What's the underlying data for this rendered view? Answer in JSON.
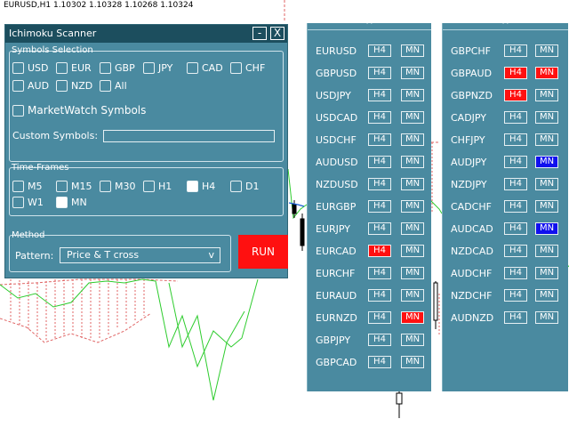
{
  "chart": {
    "header": "EURUSD,H1  1.10302 1.10328 1.10268 1.10324"
  },
  "dialog": {
    "title": "Ichimoku Scanner",
    "minimize_label": "-",
    "close_label": "X",
    "symbols_section_label": "Symbols Selection",
    "currencies": [
      {
        "label": "USD",
        "checked": false
      },
      {
        "label": "EUR",
        "checked": false
      },
      {
        "label": "GBP",
        "checked": false
      },
      {
        "label": "JPY",
        "checked": false
      },
      {
        "label": "CAD",
        "checked": false
      },
      {
        "label": "CHF",
        "checked": false
      },
      {
        "label": "AUD",
        "checked": false
      },
      {
        "label": "NZD",
        "checked": false
      },
      {
        "label": "All",
        "checked": false
      }
    ],
    "marketwatch_label": "MarketWatch Symbols",
    "custom_symbols_label": "Custom Symbols:",
    "custom_symbols_value": "",
    "timeframes_section_label": "Time-Frames",
    "timeframes": [
      {
        "label": "M5",
        "checked": false
      },
      {
        "label": "M15",
        "checked": false
      },
      {
        "label": "M30",
        "checked": false
      },
      {
        "label": "H1",
        "checked": false
      },
      {
        "label": "H4",
        "checked": true
      },
      {
        "label": "D1",
        "checked": false
      },
      {
        "label": "W1",
        "checked": false
      },
      {
        "label": "MN",
        "checked": true
      }
    ],
    "method_section_label": "Method",
    "pattern_label": "Pattern:",
    "pattern_value": "Price & T cross",
    "pattern_arrow": "v",
    "run_label": "RUN"
  },
  "panel_collapse_glyph": "^",
  "panels": [
    {
      "rows": [
        {
          "symbol": "EURUSD",
          "h4": {
            "label": "H4",
            "state": "none"
          },
          "mn": {
            "label": "MN",
            "state": "none"
          }
        },
        {
          "symbol": "GBPUSD",
          "h4": {
            "label": "H4",
            "state": "none"
          },
          "mn": {
            "label": "MN",
            "state": "none"
          }
        },
        {
          "symbol": "USDJPY",
          "h4": {
            "label": "H4",
            "state": "none"
          },
          "mn": {
            "label": "MN",
            "state": "none"
          }
        },
        {
          "symbol": "USDCAD",
          "h4": {
            "label": "H4",
            "state": "none"
          },
          "mn": {
            "label": "MN",
            "state": "none"
          }
        },
        {
          "symbol": "USDCHF",
          "h4": {
            "label": "H4",
            "state": "none"
          },
          "mn": {
            "label": "MN",
            "state": "none"
          }
        },
        {
          "symbol": "AUDUSD",
          "h4": {
            "label": "H4",
            "state": "none"
          },
          "mn": {
            "label": "MN",
            "state": "none"
          }
        },
        {
          "symbol": "NZDUSD",
          "h4": {
            "label": "H4",
            "state": "none"
          },
          "mn": {
            "label": "MN",
            "state": "none"
          }
        },
        {
          "symbol": "EURGBP",
          "h4": {
            "label": "H4",
            "state": "none"
          },
          "mn": {
            "label": "MN",
            "state": "none"
          }
        },
        {
          "symbol": "EURJPY",
          "h4": {
            "label": "H4",
            "state": "none"
          },
          "mn": {
            "label": "MN",
            "state": "none"
          }
        },
        {
          "symbol": "EURCAD",
          "h4": {
            "label": "H4",
            "state": "sell"
          },
          "mn": {
            "label": "MN",
            "state": "none"
          }
        },
        {
          "symbol": "EURCHF",
          "h4": {
            "label": "H4",
            "state": "none"
          },
          "mn": {
            "label": "MN",
            "state": "none"
          }
        },
        {
          "symbol": "EURAUD",
          "h4": {
            "label": "H4",
            "state": "none"
          },
          "mn": {
            "label": "MN",
            "state": "none"
          }
        },
        {
          "symbol": "EURNZD",
          "h4": {
            "label": "H4",
            "state": "none"
          },
          "mn": {
            "label": "MN",
            "state": "sell"
          }
        },
        {
          "symbol": "GBPJPY",
          "h4": {
            "label": "H4",
            "state": "none"
          },
          "mn": {
            "label": "MN",
            "state": "none"
          }
        },
        {
          "symbol": "GBPCAD",
          "h4": {
            "label": "H4",
            "state": "none"
          },
          "mn": {
            "label": "MN",
            "state": "none"
          }
        }
      ]
    },
    {
      "rows": [
        {
          "symbol": "GBPCHF",
          "h4": {
            "label": "H4",
            "state": "none"
          },
          "mn": {
            "label": "MN",
            "state": "none"
          }
        },
        {
          "symbol": "GBPAUD",
          "h4": {
            "label": "H4",
            "state": "sell"
          },
          "mn": {
            "label": "MN",
            "state": "sell"
          }
        },
        {
          "symbol": "GBPNZD",
          "h4": {
            "label": "H4",
            "state": "sell"
          },
          "mn": {
            "label": "MN",
            "state": "none"
          }
        },
        {
          "symbol": "CADJPY",
          "h4": {
            "label": "H4",
            "state": "none"
          },
          "mn": {
            "label": "MN",
            "state": "none"
          }
        },
        {
          "symbol": "CHFJPY",
          "h4": {
            "label": "H4",
            "state": "none"
          },
          "mn": {
            "label": "MN",
            "state": "none"
          }
        },
        {
          "symbol": "AUDJPY",
          "h4": {
            "label": "H4",
            "state": "none"
          },
          "mn": {
            "label": "MN",
            "state": "buy"
          }
        },
        {
          "symbol": "NZDJPY",
          "h4": {
            "label": "H4",
            "state": "none"
          },
          "mn": {
            "label": "MN",
            "state": "none"
          }
        },
        {
          "symbol": "CADCHF",
          "h4": {
            "label": "H4",
            "state": "none"
          },
          "mn": {
            "label": "MN",
            "state": "none"
          }
        },
        {
          "symbol": "AUDCAD",
          "h4": {
            "label": "H4",
            "state": "none"
          },
          "mn": {
            "label": "MN",
            "state": "buy"
          }
        },
        {
          "symbol": "NZDCAD",
          "h4": {
            "label": "H4",
            "state": "none"
          },
          "mn": {
            "label": "MN",
            "state": "none"
          }
        },
        {
          "symbol": "AUDCHF",
          "h4": {
            "label": "H4",
            "state": "none"
          },
          "mn": {
            "label": "MN",
            "state": "none"
          }
        },
        {
          "symbol": "NZDCHF",
          "h4": {
            "label": "H4",
            "state": "none"
          },
          "mn": {
            "label": "MN",
            "state": "none"
          }
        },
        {
          "symbol": "AUDNZD",
          "h4": {
            "label": "H4",
            "state": "none"
          },
          "mn": {
            "label": "MN",
            "state": "none"
          }
        }
      ]
    }
  ],
  "colors": {
    "panel_bg": "#4a8aa0",
    "titlebar_bg": "#1c4e5e",
    "sell_signal": "#ff1010",
    "buy_signal": "#1010ee",
    "run_button": "#ff1010",
    "cloud_line": "#2ecc2e",
    "cloud_hatch": "#e06666"
  }
}
